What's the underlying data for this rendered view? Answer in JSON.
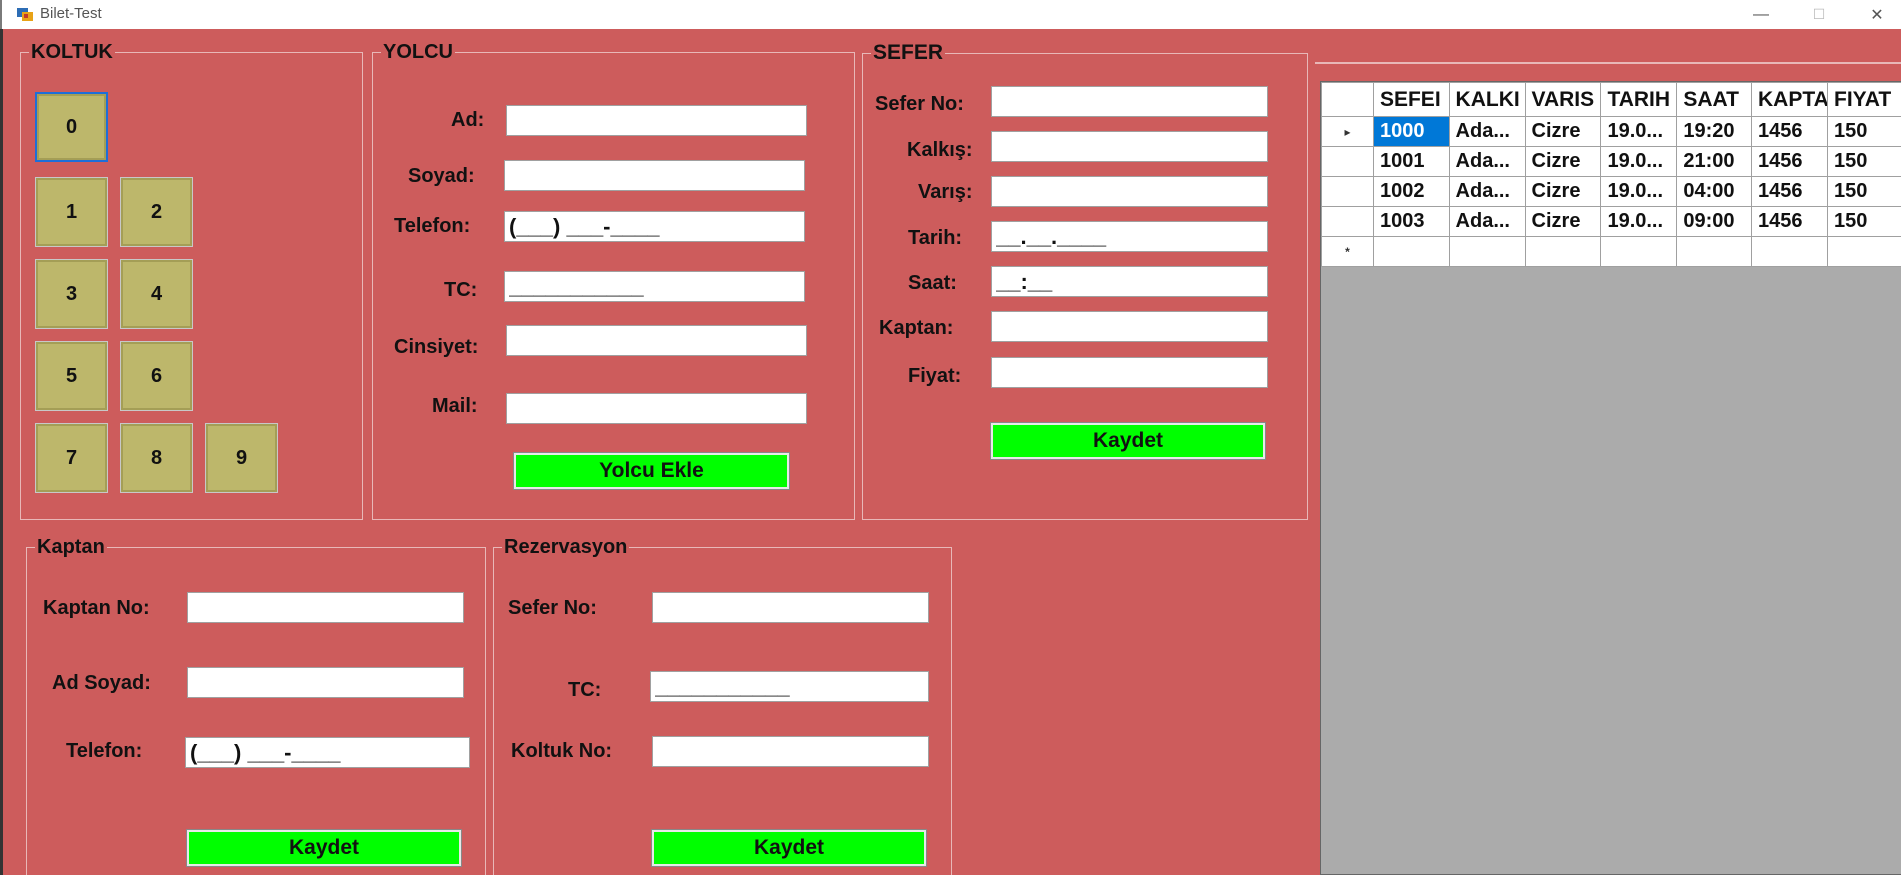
{
  "window": {
    "title": "Bilet-Test",
    "minimize": "—",
    "maximize": "☐",
    "close": "✕"
  },
  "koltuk": {
    "title": "KOLTUK",
    "seats": [
      "0",
      "1",
      "2",
      "3",
      "4",
      "5",
      "6",
      "7",
      "8",
      "9"
    ]
  },
  "yolcu": {
    "title": "YOLCU",
    "labels": {
      "ad": "Ad:",
      "soyad": "Soyad:",
      "telefon": "Telefon:",
      "tc": "TC:",
      "cinsiyet": "Cinsiyet:",
      "mail": "Mail:"
    },
    "masks": {
      "telefon": "(___) ___-____",
      "tc": "___________"
    },
    "button": "Yolcu Ekle"
  },
  "sefer": {
    "title": "SEFER",
    "labels": {
      "sefer_no": "Sefer No:",
      "kalkis": "Kalkış:",
      "varis": "Varış:",
      "tarih": "Tarih:",
      "saat": "Saat:",
      "kaptan": "Kaptan:",
      "fiyat": "Fiyat:"
    },
    "masks": {
      "tarih": "__.__.____",
      "saat": "__:__"
    },
    "button": "Kaydet"
  },
  "kaptan": {
    "title": "Kaptan",
    "labels": {
      "kaptan_no": "Kaptan No:",
      "ad_soyad": "Ad Soyad:",
      "telefon": "Telefon:"
    },
    "masks": {
      "telefon": "(___) ___-____"
    },
    "button": "Kaydet"
  },
  "rezervasyon": {
    "title": "Rezervasyon",
    "labels": {
      "sefer_no": "Sefer No:",
      "tc": "TC:",
      "koltuk_no": "Koltuk No:"
    },
    "masks": {
      "tc": "___________"
    },
    "button": "Kaydet"
  },
  "grid": {
    "columns": [
      "SEFEI",
      "KALKI",
      "VARIS",
      "TARIH",
      "SAAT",
      "KAPTA",
      "FIYAT"
    ],
    "rows": [
      [
        "1000",
        "Ada...",
        "Cizre",
        "19.0...",
        "19:20",
        "1456",
        "150"
      ],
      [
        "1001",
        "Ada...",
        "Cizre",
        "19.0...",
        "21:00",
        "1456",
        "150"
      ],
      [
        "1002",
        "Ada...",
        "Cizre",
        "19.0...",
        "04:00",
        "1456",
        "150"
      ],
      [
        "1003",
        "Ada...",
        "Cizre",
        "19.0...",
        "09:00",
        "1456",
        "150"
      ]
    ],
    "current_row_marker": "▸",
    "new_row_marker": "*"
  }
}
